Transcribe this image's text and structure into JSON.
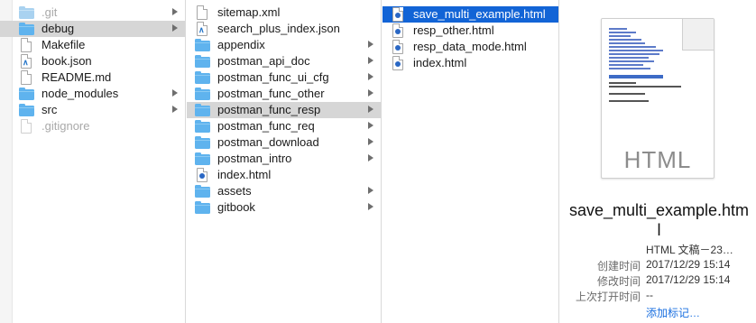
{
  "column1": [
    {
      "name": ".git",
      "kind": "folder",
      "dim": true,
      "arrow": true
    },
    {
      "name": "debug",
      "kind": "folder",
      "selected": "gray",
      "arrow": true
    },
    {
      "name": "Makefile",
      "kind": "doc"
    },
    {
      "name": "book.json",
      "kind": "vscode"
    },
    {
      "name": "README.md",
      "kind": "doc"
    },
    {
      "name": "node_modules",
      "kind": "folder",
      "arrow": true
    },
    {
      "name": "src",
      "kind": "folder",
      "arrow": true
    },
    {
      "name": ".gitignore",
      "kind": "doc",
      "dim": true
    }
  ],
  "column2": [
    {
      "name": "sitemap.xml",
      "kind": "doc"
    },
    {
      "name": "search_plus_index.json",
      "kind": "vscode"
    },
    {
      "name": "appendix",
      "kind": "folder",
      "arrow": true
    },
    {
      "name": "postman_api_doc",
      "kind": "folder",
      "arrow": true
    },
    {
      "name": "postman_func_ui_cfg",
      "kind": "folder",
      "arrow": true
    },
    {
      "name": "postman_func_other",
      "kind": "folder",
      "arrow": true
    },
    {
      "name": "postman_func_resp",
      "kind": "folder",
      "selected": "gray",
      "arrow": true
    },
    {
      "name": "postman_func_req",
      "kind": "folder",
      "arrow": true
    },
    {
      "name": "postman_download",
      "kind": "folder",
      "arrow": true
    },
    {
      "name": "postman_intro",
      "kind": "folder",
      "arrow": true
    },
    {
      "name": "index.html",
      "kind": "html"
    },
    {
      "name": "assets",
      "kind": "folder",
      "arrow": true
    },
    {
      "name": "gitbook",
      "kind": "folder",
      "arrow": true
    }
  ],
  "column3": [
    {
      "name": "save_multi_example.html",
      "kind": "html",
      "selected": "blue"
    },
    {
      "name": "resp_other.html",
      "kind": "html"
    },
    {
      "name": "resp_data_mode.html",
      "kind": "html"
    },
    {
      "name": "index.html",
      "kind": "html"
    }
  ],
  "preview": {
    "type_label": "HTML",
    "file_name": "save_multi_example.htm l",
    "kind": "HTML 文稿－23…",
    "created_label": "创建时间",
    "created_value": "2017/12/29 15:14",
    "modified_label": "修改时间",
    "modified_value": "2017/12/29 15:14",
    "opened_label": "上次打开时间",
    "opened_value": "--",
    "add_tags": "添加标记…"
  },
  "colors": {
    "selection_blue": "#1264d6",
    "selection_gray": "#d6d6d6",
    "folder_blue": "#5fb3ee",
    "link_blue": "#1a6fe0"
  }
}
